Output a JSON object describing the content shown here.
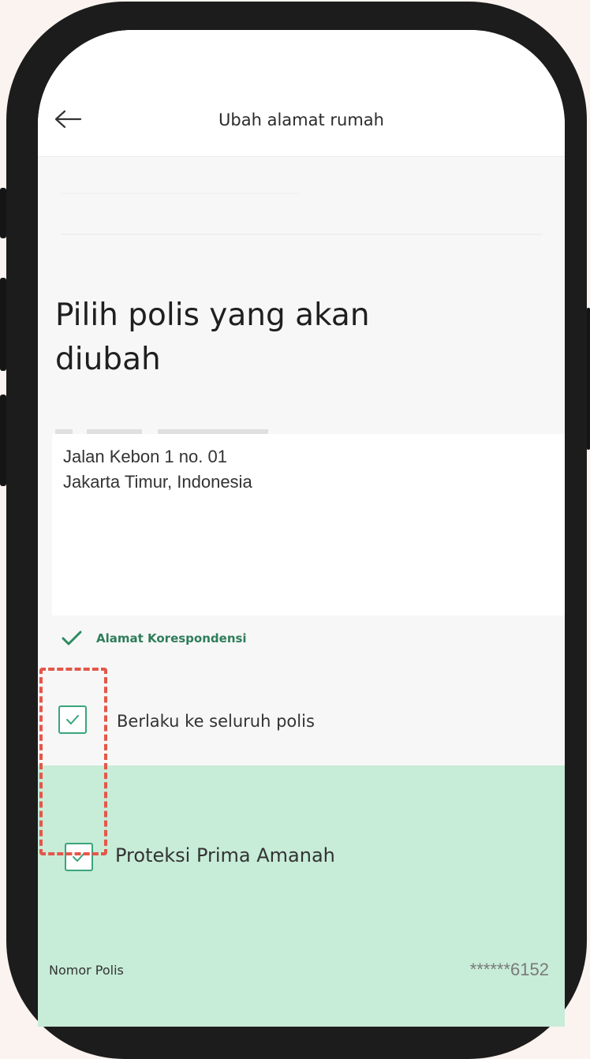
{
  "app": {
    "title": "Ubah alamat rumah",
    "heading": "Pilih polis yang akan diubah"
  },
  "address": {
    "line1": "Jalan Kebon 1 no. 01",
    "line2": "Jakarta Timur, Indonesia"
  },
  "correspondence": {
    "label": "Alamat Korespondensi"
  },
  "options": {
    "all_policies_label": "Berlaku ke seluruh polis",
    "all_policies_checked": true,
    "policy_label": "Proteksi Prima Amanah",
    "policy_checked": true
  },
  "policy": {
    "number_label": "Nomor Polis",
    "number_value": "******6152"
  },
  "colors": {
    "accent_green": "#3aa57a",
    "section_green": "#c7ecd8",
    "highlight_red": "#e4574a"
  },
  "icons": {
    "back": "arrow-left-icon",
    "check": "checkmark-icon"
  }
}
